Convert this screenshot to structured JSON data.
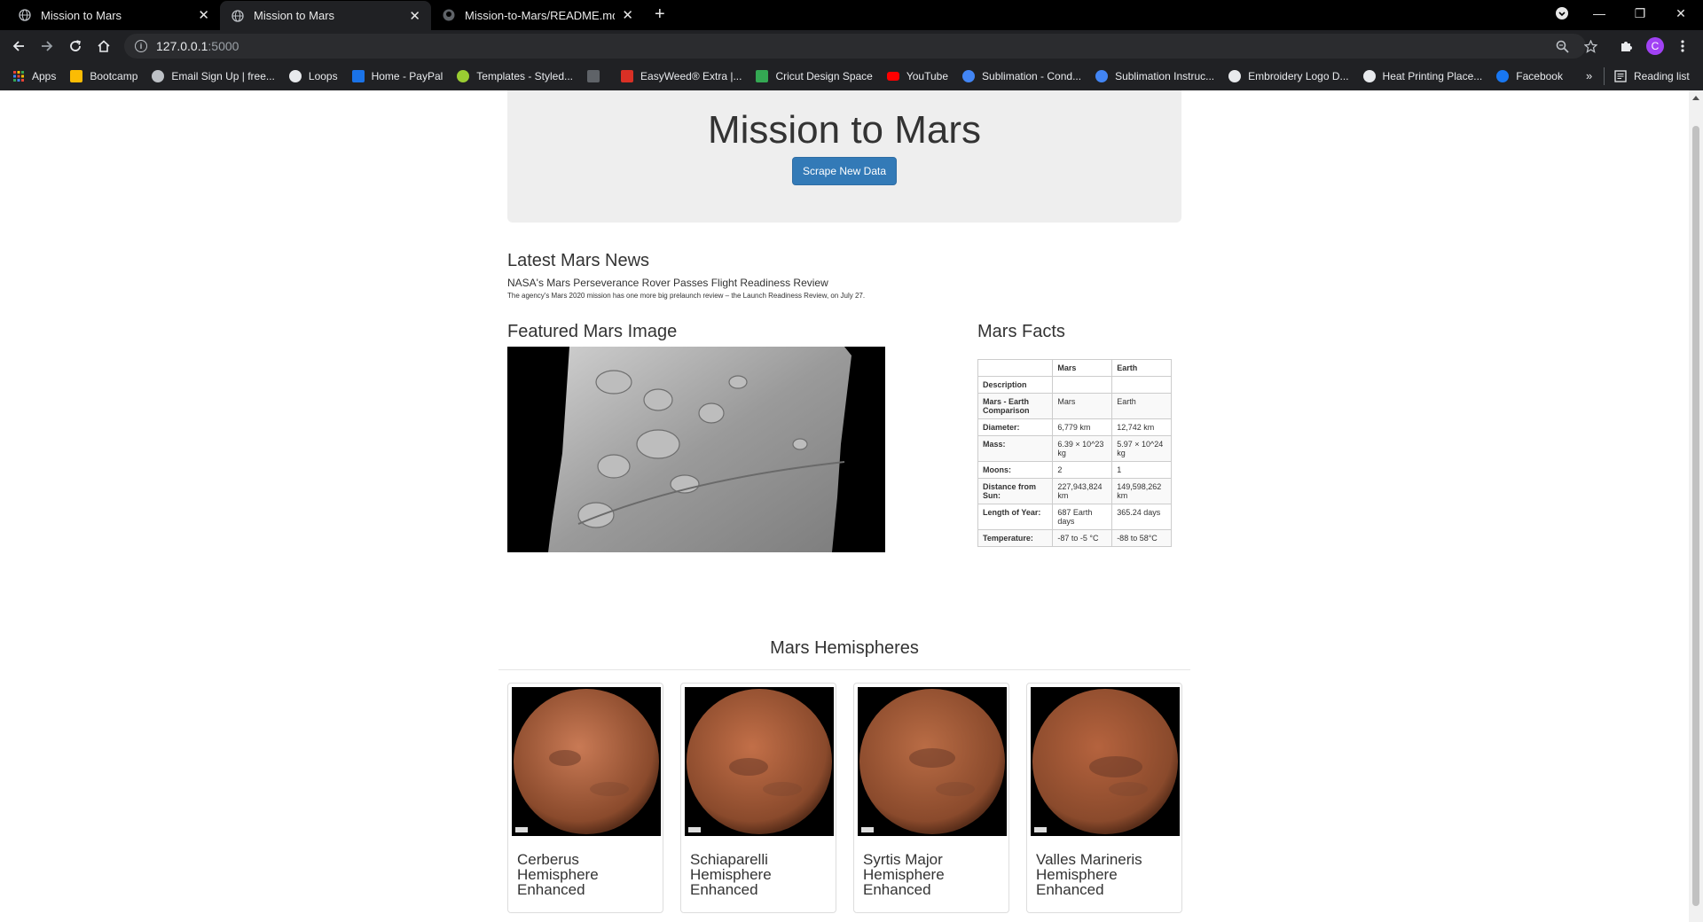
{
  "tabs": [
    {
      "title": "Mission to Mars",
      "active": false
    },
    {
      "title": "Mission to Mars",
      "active": true
    },
    {
      "title": "Mission-to-Mars/README.md at",
      "active": false
    }
  ],
  "address": {
    "host": "127.0.0.1",
    "port": ":5000"
  },
  "bookmarks": [
    {
      "label": "Apps",
      "icon": "apps-grid-icon",
      "color": "#ea4335"
    },
    {
      "label": "Bootcamp",
      "icon": "folder-icon",
      "color": "#fbbc04"
    },
    {
      "label": "Email Sign Up | free...",
      "icon": "site-icon",
      "color": "#bdc1c6"
    },
    {
      "label": "Loops",
      "icon": "site-icon",
      "color": "#e8eaed"
    },
    {
      "label": "Home - PayPal",
      "icon": "paypal-icon",
      "color": "#1a73e8"
    },
    {
      "label": "Templates - Styled...",
      "icon": "site-icon",
      "color": "#9acd32"
    },
    {
      "label": "",
      "icon": "b-icon",
      "color": "#5f6368"
    },
    {
      "label": "EasyWeed® Extra |...",
      "icon": "s-icon",
      "color": "#d93025"
    },
    {
      "label": "Cricut Design Space",
      "icon": "c-icon",
      "color": "#34a853"
    },
    {
      "label": "YouTube",
      "icon": "youtube-icon",
      "color": "#ff0000"
    },
    {
      "label": "Sublimation - Cond...",
      "icon": "site-icon",
      "color": "#4285f4"
    },
    {
      "label": "Sublimation Instruc...",
      "icon": "site-icon",
      "color": "#4285f4"
    },
    {
      "label": "Embroidery Logo D...",
      "icon": "site-icon",
      "color": "#e8eaed"
    },
    {
      "label": "Heat Printing Place...",
      "icon": "site-icon",
      "color": "#e8eaed"
    },
    {
      "label": "Facebook",
      "icon": "facebook-icon",
      "color": "#1877f2"
    }
  ],
  "reading_list": "Reading list",
  "page": {
    "title": "Mission to Mars",
    "scrape_button": "Scrape New Data",
    "news_heading": "Latest Mars News",
    "news_title": "NASA's Mars Perseverance Rover Passes Flight Readiness Review",
    "news_paragraph": "The agency's Mars 2020 mission has one more big prelaunch review – the Launch Readiness Review, on July 27.",
    "featured_heading": "Featured Mars Image",
    "facts_heading": "Mars Facts",
    "facts": {
      "headers": [
        "",
        "Mars",
        "Earth"
      ],
      "rows": [
        [
          "Description",
          "",
          ""
        ],
        [
          "Mars - Earth Comparison",
          "Mars",
          "Earth"
        ],
        [
          "Diameter:",
          "6,779 km",
          "12,742 km"
        ],
        [
          "Mass:",
          "6.39 × 10^23 kg",
          "5.97 × 10^24 kg"
        ],
        [
          "Moons:",
          "2",
          "1"
        ],
        [
          "Distance from Sun:",
          "227,943,824 km",
          "149,598,262 km"
        ],
        [
          "Length of Year:",
          "687 Earth days",
          "365.24 days"
        ],
        [
          "Temperature:",
          "-87 to -5 °C",
          "-88 to 58°C"
        ]
      ]
    },
    "hemispheres_heading": "Mars Hemispheres",
    "hemispheres": [
      {
        "title": "Cerberus Hemisphere Enhanced",
        "color": "#c97a55"
      },
      {
        "title": "Schiaparelli Hemisphere Enhanced",
        "color": "#c26f48"
      },
      {
        "title": "Syrtis Major Hemisphere Enhanced",
        "color": "#b96c45"
      },
      {
        "title": "Valles Marineris Hemisphere Enhanced",
        "color": "#b5633e"
      }
    ]
  }
}
